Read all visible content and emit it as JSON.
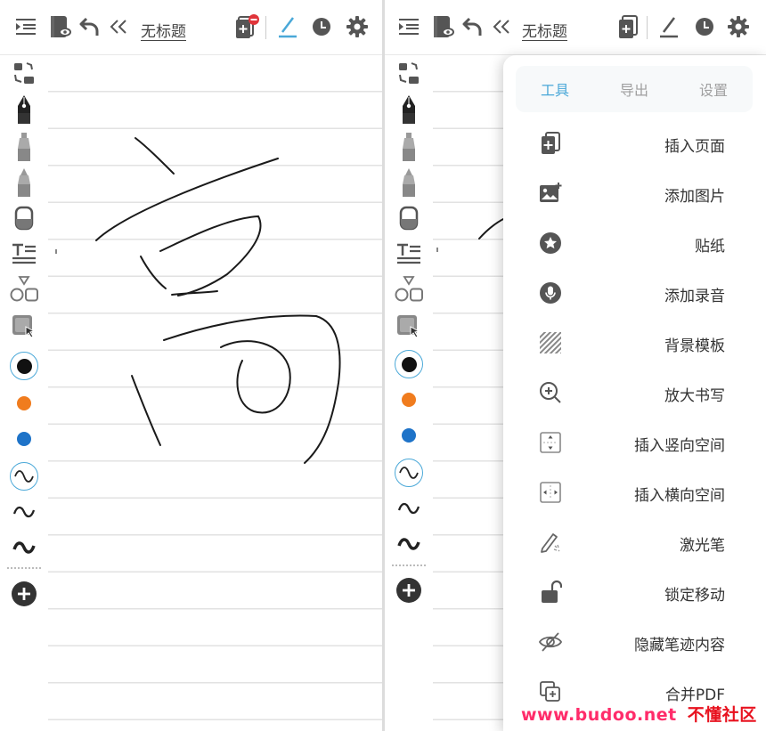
{
  "document": {
    "title": "无标题"
  },
  "colors": {
    "accent": "#4aa8d8",
    "black": "#111111",
    "orange": "#f07c1e",
    "blue": "#1e73c8",
    "watermark": "#ff2c6a"
  },
  "toolbar_icons": [
    "outline-icon",
    "notebook-preview-icon",
    "undo-icon",
    "collapse-icon",
    "add-page-icon",
    "pen-active-icon",
    "history-icon",
    "settings-icon"
  ],
  "sidebar_tools": [
    "lasso-icon",
    "fountain-pen-icon",
    "marker-icon",
    "highlighter-icon",
    "eraser-icon",
    "text-icon",
    "shapes-icon",
    "select-icon"
  ],
  "pen_colors": [
    "#111111",
    "#f07c1e",
    "#1e73c8"
  ],
  "stroke_styles": [
    "smooth-stroke",
    "medium-stroke",
    "bold-stroke"
  ],
  "menu": {
    "tabs": [
      {
        "label": "工具",
        "active": true
      },
      {
        "label": "导出",
        "active": false
      },
      {
        "label": "设置",
        "active": false
      }
    ],
    "items": [
      {
        "label": "插入页面",
        "icon": "insert-page-icon"
      },
      {
        "label": "添加图片",
        "icon": "add-image-icon"
      },
      {
        "label": "贴纸",
        "icon": "sticker-icon"
      },
      {
        "label": "添加录音",
        "icon": "microphone-icon"
      },
      {
        "label": "背景模板",
        "icon": "background-template-icon"
      },
      {
        "label": "放大书写",
        "icon": "zoom-write-icon"
      },
      {
        "label": "插入竖向空间",
        "icon": "vertical-space-icon"
      },
      {
        "label": "插入横向空间",
        "icon": "horizontal-space-icon"
      },
      {
        "label": "激光笔",
        "icon": "laser-pointer-icon"
      },
      {
        "label": "锁定移动",
        "icon": "lock-icon"
      },
      {
        "label": "隐藏笔迹内容",
        "icon": "hide-ink-icon"
      },
      {
        "label": "合并PDF",
        "icon": "merge-pdf-icon"
      }
    ]
  },
  "watermark": {
    "site": "www.budoo.net",
    "name": "不懂社区"
  }
}
